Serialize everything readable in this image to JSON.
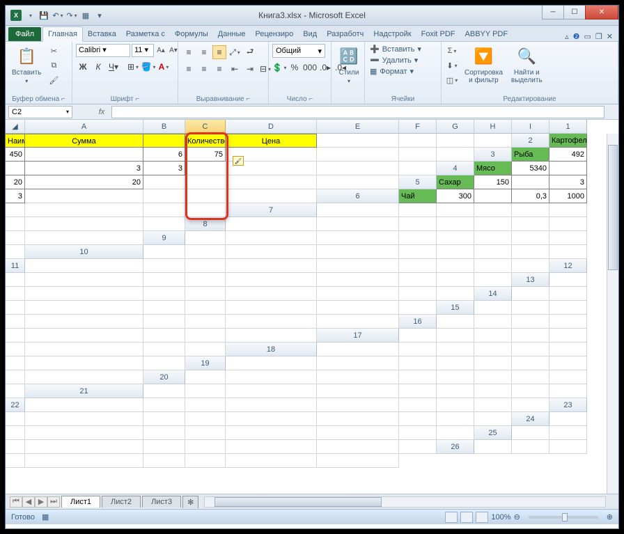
{
  "title": "Книга3.xlsx - Microsoft Excel",
  "qat": {
    "save": "💾",
    "undo": "↶",
    "redo": "↷",
    "more": "▾"
  },
  "tabs": {
    "file": "Файл",
    "items": [
      "Главная",
      "Вставка",
      "Разметка с",
      "Формулы",
      "Данные",
      "Рецензиро",
      "Вид",
      "Разработч",
      "Надстройк",
      "Foxit PDF",
      "ABBYY PDF"
    ],
    "activeIndex": 0
  },
  "ribbon": {
    "clipboard": {
      "paste": "Вставить",
      "label": "Буфер обмена"
    },
    "font": {
      "name": "Calibri",
      "size": "11",
      "label": "Шрифт"
    },
    "align": {
      "label": "Выравнивание"
    },
    "number": {
      "format": "Общий",
      "label": "Число"
    },
    "styles": {
      "btn": "Стили"
    },
    "cells": {
      "insert": "Вставить",
      "delete": "Удалить",
      "format": "Формат",
      "label": "Ячейки"
    },
    "editing": {
      "sort": "Сортировка\nи фильтр",
      "find": "Найти и\nвыделить",
      "label": "Редактирование"
    }
  },
  "namebox": "C2",
  "columns": [
    "A",
    "B",
    "C",
    "D",
    "E",
    "F",
    "G",
    "H",
    "I"
  ],
  "headers": {
    "A": "Наименование товара",
    "B": "Сумма",
    "C": "",
    "D": "Количество",
    "E": "Цена"
  },
  "rows": [
    {
      "n": "1"
    },
    {
      "n": "2",
      "A": "Картофель",
      "B": "450",
      "D": "6",
      "E": "75"
    },
    {
      "n": "3",
      "A": "Рыба",
      "B": "492",
      "D": "3",
      "E": "3"
    },
    {
      "n": "4",
      "A": "Мясо",
      "B": "5340",
      "D": "20",
      "E": "20"
    },
    {
      "n": "5",
      "A": "Сахар",
      "B": "150",
      "D": "3",
      "E": "3"
    },
    {
      "n": "6",
      "A": "Чай",
      "B": "300",
      "D": "0,3",
      "E": "1000"
    }
  ],
  "emptyRows": [
    "7",
    "8",
    "9",
    "10",
    "11",
    "12",
    "13",
    "14",
    "15",
    "16",
    "17",
    "18",
    "19",
    "20",
    "21",
    "22",
    "23",
    "24",
    "25",
    "26"
  ],
  "sheets": [
    "Лист1",
    "Лист2",
    "Лист3"
  ],
  "status": "Готово",
  "zoom": "100%"
}
